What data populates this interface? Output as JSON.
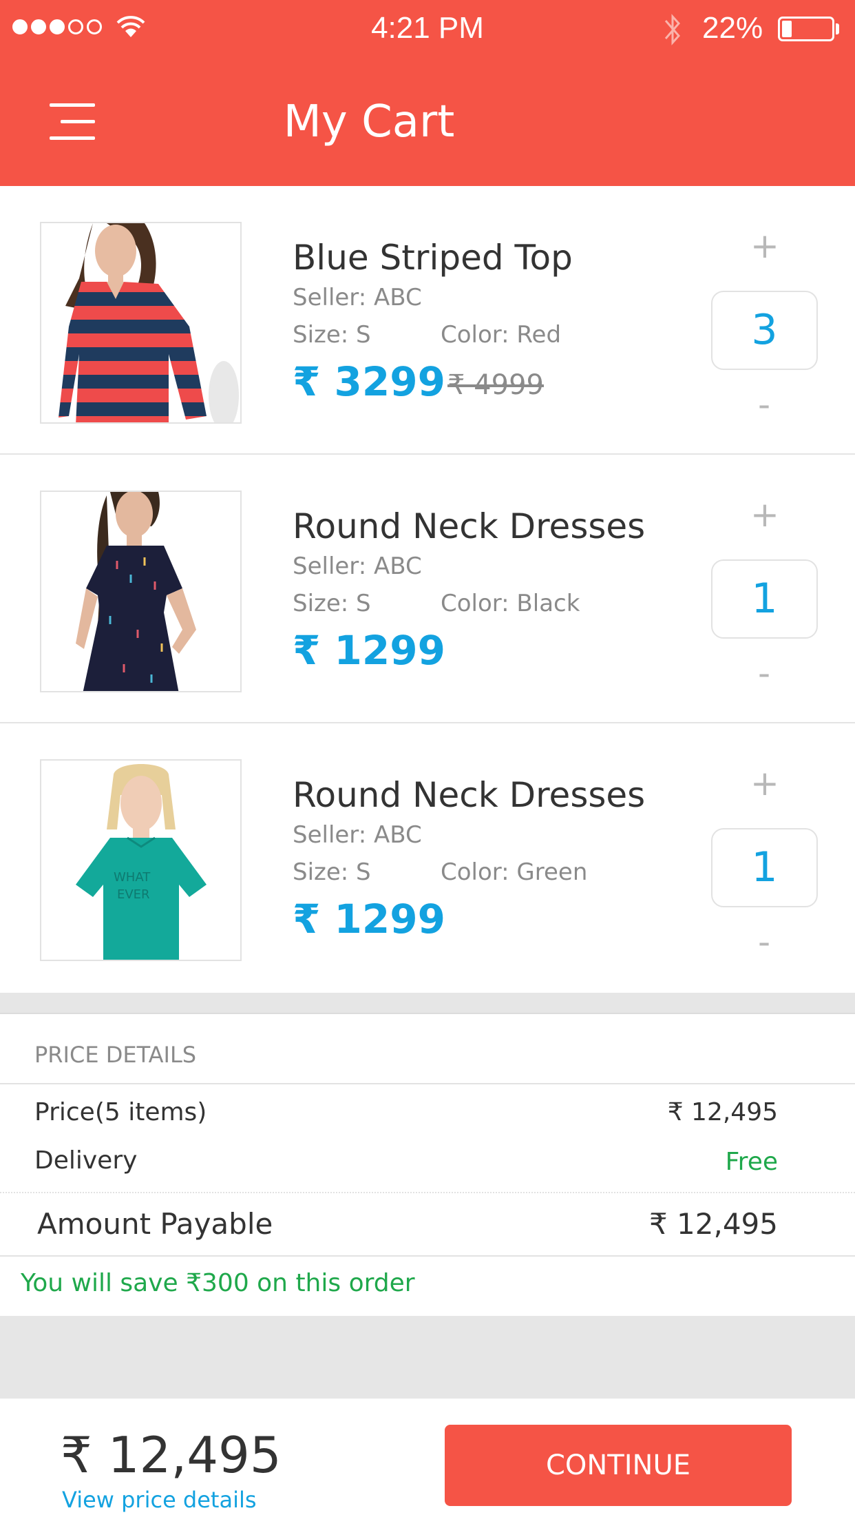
{
  "status_bar": {
    "time": "4:21 PM",
    "battery": "22%"
  },
  "header": {
    "title": "My Cart"
  },
  "cart": {
    "items": [
      {
        "name": "Blue Striped Top",
        "seller": "Seller: ABC",
        "size": "Size:  S",
        "color": "Color:  Red",
        "price": "₹ 3299",
        "mrp": "₹ 4999",
        "qty": "3",
        "plus": "+",
        "minus": "-"
      },
      {
        "name": "Round Neck Dresses",
        "seller": "Seller: ABC",
        "size": "Size:  S",
        "color": "Color:  Black",
        "price": "₹ 1299",
        "mrp": "",
        "qty": "1",
        "plus": "+",
        "minus": "-"
      },
      {
        "name": "Round Neck Dresses",
        "seller": "Seller: ABC",
        "size": "Size:  S",
        "color": "Color:  Green",
        "price": "₹ 1299",
        "mrp": "",
        "qty": "1",
        "plus": "+",
        "minus": "-"
      }
    ]
  },
  "price_details": {
    "heading": "PRICE DETAILS",
    "price_label": "Price(5 items)",
    "price_value": "₹ 12,495",
    "delivery_label": "Delivery",
    "delivery_value": "Free",
    "amount_label": "Amount Payable",
    "amount_value": "₹ 12,495",
    "savings_note": "You will save ₹300 on this order"
  },
  "footer": {
    "total": "₹ 12,495",
    "view_details": "View price details",
    "continue_label": "CONTINUE"
  },
  "colors": {
    "accent": "#f55446",
    "price_blue": "#13a2e0",
    "green": "#1fa84b"
  }
}
